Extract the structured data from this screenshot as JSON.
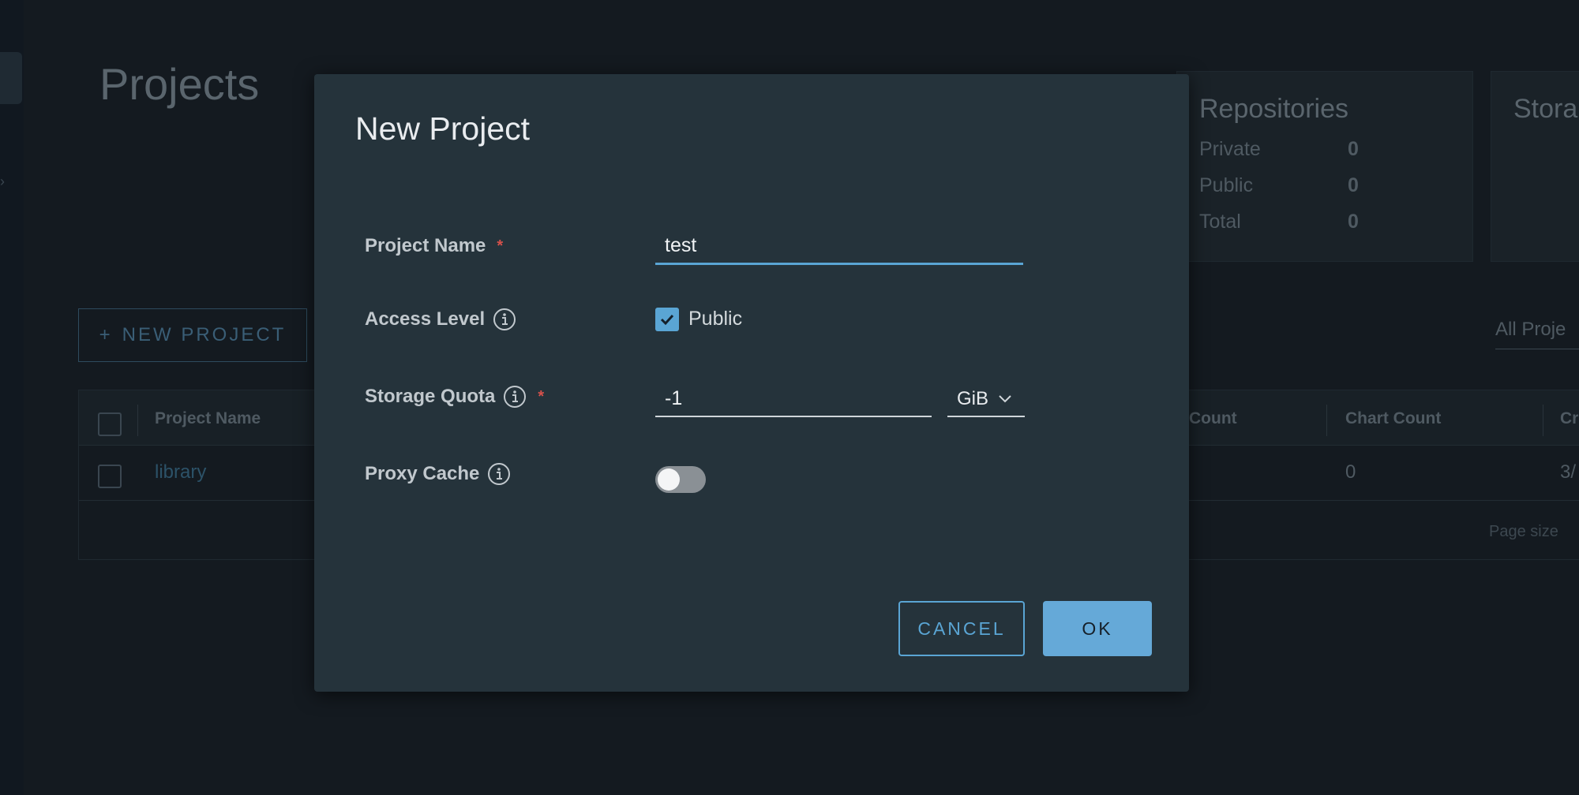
{
  "background": {
    "page_title": "Projects",
    "repositories_card": {
      "title": "Repositories",
      "rows": [
        {
          "label": "Private",
          "value": "0"
        },
        {
          "label": "Public",
          "value": "0"
        },
        {
          "label": "Total",
          "value": "0"
        }
      ]
    },
    "storage_card": {
      "title": "Stora"
    },
    "new_project_label": "NEW PROJECT",
    "filter_label": "All Proje",
    "table": {
      "headers": [
        "Project Name",
        "Count",
        "Chart Count",
        "Cr"
      ],
      "rows": [
        {
          "name": "library",
          "chart_count": "0",
          "created": "3/"
        }
      ],
      "page_size_label": "Page size"
    }
  },
  "modal": {
    "title": "New Project",
    "fields": {
      "project_name": {
        "label": "Project Name",
        "value": "test"
      },
      "access_level": {
        "label": "Access Level",
        "checkbox_label": "Public",
        "checked": true
      },
      "storage_quota": {
        "label": "Storage Quota",
        "value": "-1",
        "unit": "GiB"
      },
      "proxy_cache": {
        "label": "Proxy Cache",
        "enabled": false
      }
    },
    "buttons": {
      "cancel": "CANCEL",
      "ok": "OK"
    },
    "colors": {
      "accent": "#5aa5d4",
      "required": "#d6514b",
      "surface": "#25333b"
    }
  },
  "icons": {
    "info": "info-circle-icon",
    "check": "check-icon",
    "chevron": "chevron-down-icon",
    "plus": "plus-icon"
  }
}
